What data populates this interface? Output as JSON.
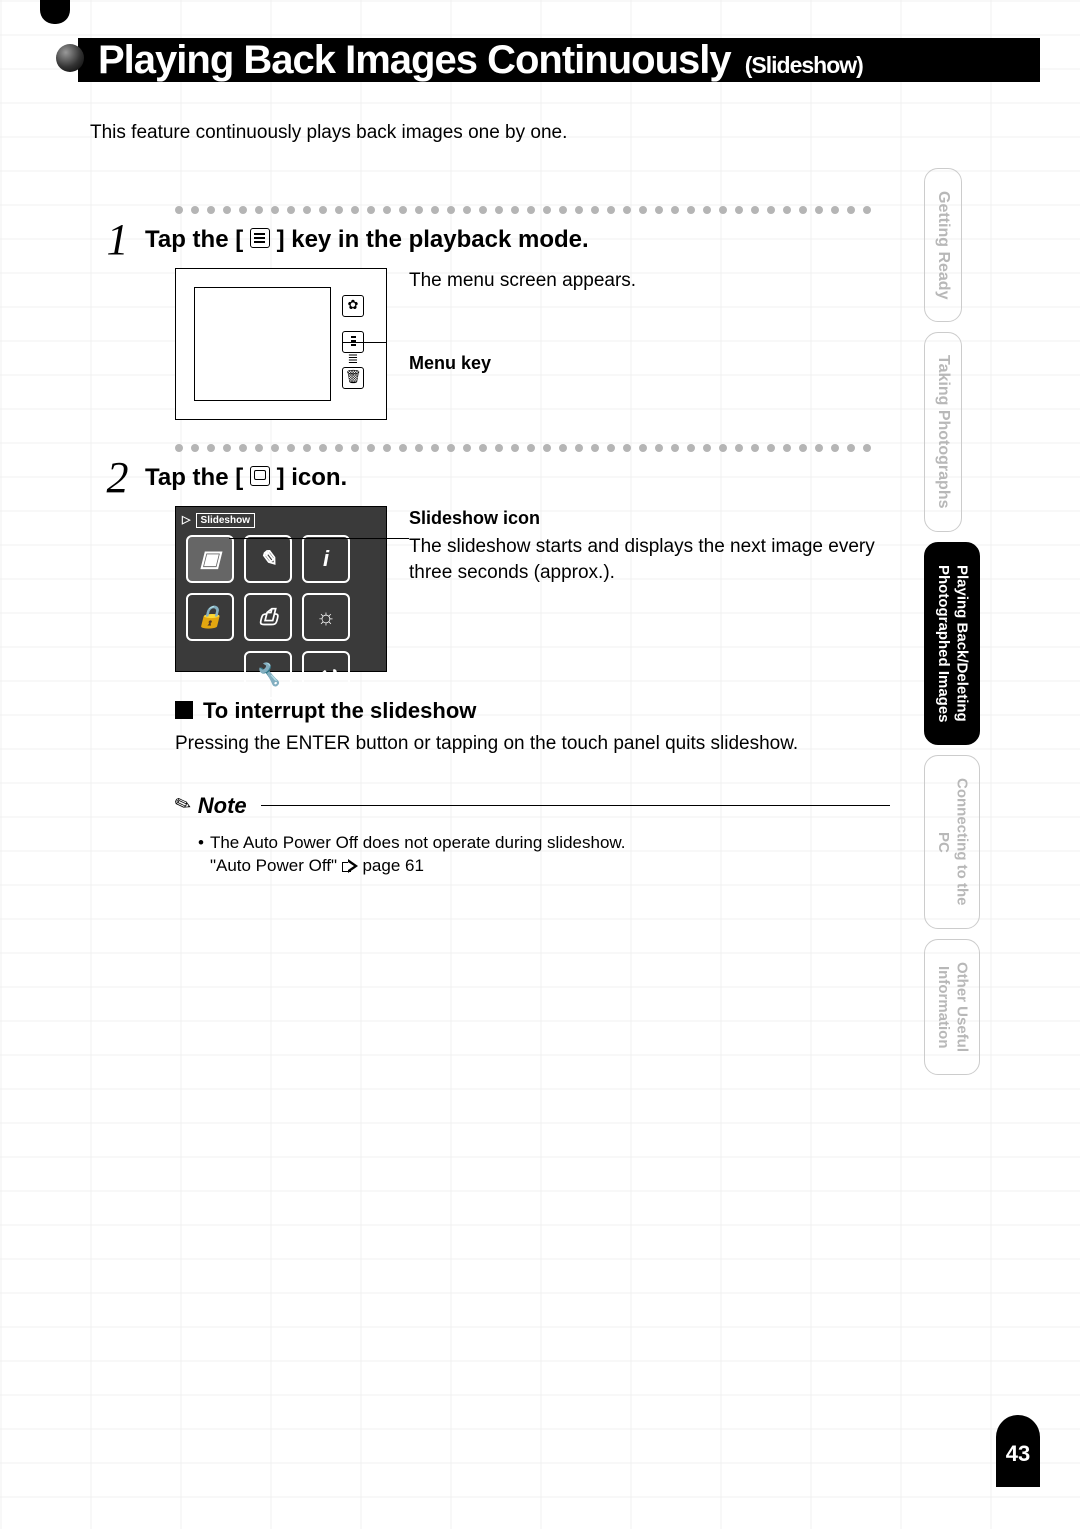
{
  "header": {
    "title_main": "Playing Back Images Continuously",
    "title_sub": "(Slideshow)"
  },
  "intro": "This feature continuously plays back images one by one.",
  "step1": {
    "num": "1",
    "title_pre": "Tap the [ ",
    "title_post": " ] key in the playback mode.",
    "desc": "The menu screen appears.",
    "callout": "Menu key"
  },
  "step2": {
    "num": "2",
    "title_pre": "Tap the [ ",
    "title_post": " ] icon.",
    "callout": "Slideshow icon",
    "desc": "The slideshow starts and displays the next image every three seconds (approx.).",
    "screen_label_left": "▷",
    "screen_label_box": "Slideshow",
    "icon_info": "i"
  },
  "interrupt": {
    "title": "To interrupt the slideshow",
    "body": "Pressing the ENTER button or tapping on the touch panel quits slideshow."
  },
  "note": {
    "label": "Note",
    "bullet": "•",
    "line1": "The Auto Power Off does not operate during slideshow.",
    "line2a": "\"Auto Power Off\" ",
    "line2b": "page 61"
  },
  "sidetabs": {
    "t1": "Getting Ready",
    "t2": "Taking Photographs",
    "t3a": "Playing Back/Deleting",
    "t3b": "Photographed Images",
    "t4a": "Connecting to the",
    "t4b": "PC",
    "t5a": "Other Useful",
    "t5b": "Information"
  },
  "page_number": "43"
}
